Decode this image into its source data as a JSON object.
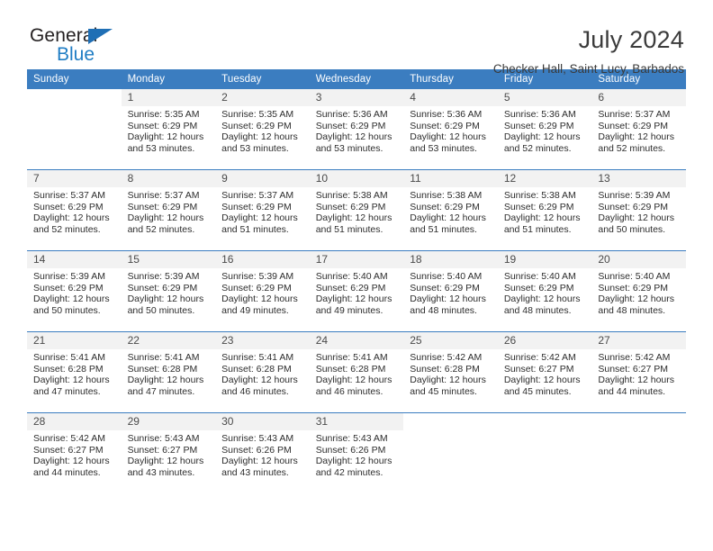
{
  "brand": {
    "name_part1": "General",
    "name_part2": "Blue",
    "triangle_color": "#1f6fb5"
  },
  "header": {
    "title": "July 2024",
    "subtitle": "Checker Hall, Saint Lucy, Barbados"
  },
  "theme": {
    "header_bg": "#3b7dc0",
    "daynum_bg": "#f2f2f2",
    "rule_color": "#3b7dc0",
    "text_color": "#2d2d2d"
  },
  "weekday_headers": [
    "Sunday",
    "Monday",
    "Tuesday",
    "Wednesday",
    "Thursday",
    "Friday",
    "Saturday"
  ],
  "weeks": [
    [
      {
        "day": "",
        "sunrise": "",
        "sunset": "",
        "daylight1": "",
        "daylight2": "",
        "blank": true
      },
      {
        "day": "1",
        "sunrise": "Sunrise: 5:35 AM",
        "sunset": "Sunset: 6:29 PM",
        "daylight1": "Daylight: 12 hours",
        "daylight2": "and 53 minutes."
      },
      {
        "day": "2",
        "sunrise": "Sunrise: 5:35 AM",
        "sunset": "Sunset: 6:29 PM",
        "daylight1": "Daylight: 12 hours",
        "daylight2": "and 53 minutes."
      },
      {
        "day": "3",
        "sunrise": "Sunrise: 5:36 AM",
        "sunset": "Sunset: 6:29 PM",
        "daylight1": "Daylight: 12 hours",
        "daylight2": "and 53 minutes."
      },
      {
        "day": "4",
        "sunrise": "Sunrise: 5:36 AM",
        "sunset": "Sunset: 6:29 PM",
        "daylight1": "Daylight: 12 hours",
        "daylight2": "and 53 minutes."
      },
      {
        "day": "5",
        "sunrise": "Sunrise: 5:36 AM",
        "sunset": "Sunset: 6:29 PM",
        "daylight1": "Daylight: 12 hours",
        "daylight2": "and 52 minutes."
      },
      {
        "day": "6",
        "sunrise": "Sunrise: 5:37 AM",
        "sunset": "Sunset: 6:29 PM",
        "daylight1": "Daylight: 12 hours",
        "daylight2": "and 52 minutes."
      }
    ],
    [
      {
        "day": "7",
        "sunrise": "Sunrise: 5:37 AM",
        "sunset": "Sunset: 6:29 PM",
        "daylight1": "Daylight: 12 hours",
        "daylight2": "and 52 minutes."
      },
      {
        "day": "8",
        "sunrise": "Sunrise: 5:37 AM",
        "sunset": "Sunset: 6:29 PM",
        "daylight1": "Daylight: 12 hours",
        "daylight2": "and 52 minutes."
      },
      {
        "day": "9",
        "sunrise": "Sunrise: 5:37 AM",
        "sunset": "Sunset: 6:29 PM",
        "daylight1": "Daylight: 12 hours",
        "daylight2": "and 51 minutes."
      },
      {
        "day": "10",
        "sunrise": "Sunrise: 5:38 AM",
        "sunset": "Sunset: 6:29 PM",
        "daylight1": "Daylight: 12 hours",
        "daylight2": "and 51 minutes."
      },
      {
        "day": "11",
        "sunrise": "Sunrise: 5:38 AM",
        "sunset": "Sunset: 6:29 PM",
        "daylight1": "Daylight: 12 hours",
        "daylight2": "and 51 minutes."
      },
      {
        "day": "12",
        "sunrise": "Sunrise: 5:38 AM",
        "sunset": "Sunset: 6:29 PM",
        "daylight1": "Daylight: 12 hours",
        "daylight2": "and 51 minutes."
      },
      {
        "day": "13",
        "sunrise": "Sunrise: 5:39 AM",
        "sunset": "Sunset: 6:29 PM",
        "daylight1": "Daylight: 12 hours",
        "daylight2": "and 50 minutes."
      }
    ],
    [
      {
        "day": "14",
        "sunrise": "Sunrise: 5:39 AM",
        "sunset": "Sunset: 6:29 PM",
        "daylight1": "Daylight: 12 hours",
        "daylight2": "and 50 minutes."
      },
      {
        "day": "15",
        "sunrise": "Sunrise: 5:39 AM",
        "sunset": "Sunset: 6:29 PM",
        "daylight1": "Daylight: 12 hours",
        "daylight2": "and 50 minutes."
      },
      {
        "day": "16",
        "sunrise": "Sunrise: 5:39 AM",
        "sunset": "Sunset: 6:29 PM",
        "daylight1": "Daylight: 12 hours",
        "daylight2": "and 49 minutes."
      },
      {
        "day": "17",
        "sunrise": "Sunrise: 5:40 AM",
        "sunset": "Sunset: 6:29 PM",
        "daylight1": "Daylight: 12 hours",
        "daylight2": "and 49 minutes."
      },
      {
        "day": "18",
        "sunrise": "Sunrise: 5:40 AM",
        "sunset": "Sunset: 6:29 PM",
        "daylight1": "Daylight: 12 hours",
        "daylight2": "and 48 minutes."
      },
      {
        "day": "19",
        "sunrise": "Sunrise: 5:40 AM",
        "sunset": "Sunset: 6:29 PM",
        "daylight1": "Daylight: 12 hours",
        "daylight2": "and 48 minutes."
      },
      {
        "day": "20",
        "sunrise": "Sunrise: 5:40 AM",
        "sunset": "Sunset: 6:29 PM",
        "daylight1": "Daylight: 12 hours",
        "daylight2": "and 48 minutes."
      }
    ],
    [
      {
        "day": "21",
        "sunrise": "Sunrise: 5:41 AM",
        "sunset": "Sunset: 6:28 PM",
        "daylight1": "Daylight: 12 hours",
        "daylight2": "and 47 minutes."
      },
      {
        "day": "22",
        "sunrise": "Sunrise: 5:41 AM",
        "sunset": "Sunset: 6:28 PM",
        "daylight1": "Daylight: 12 hours",
        "daylight2": "and 47 minutes."
      },
      {
        "day": "23",
        "sunrise": "Sunrise: 5:41 AM",
        "sunset": "Sunset: 6:28 PM",
        "daylight1": "Daylight: 12 hours",
        "daylight2": "and 46 minutes."
      },
      {
        "day": "24",
        "sunrise": "Sunrise: 5:41 AM",
        "sunset": "Sunset: 6:28 PM",
        "daylight1": "Daylight: 12 hours",
        "daylight2": "and 46 minutes."
      },
      {
        "day": "25",
        "sunrise": "Sunrise: 5:42 AM",
        "sunset": "Sunset: 6:28 PM",
        "daylight1": "Daylight: 12 hours",
        "daylight2": "and 45 minutes."
      },
      {
        "day": "26",
        "sunrise": "Sunrise: 5:42 AM",
        "sunset": "Sunset: 6:27 PM",
        "daylight1": "Daylight: 12 hours",
        "daylight2": "and 45 minutes."
      },
      {
        "day": "27",
        "sunrise": "Sunrise: 5:42 AM",
        "sunset": "Sunset: 6:27 PM",
        "daylight1": "Daylight: 12 hours",
        "daylight2": "and 44 minutes."
      }
    ],
    [
      {
        "day": "28",
        "sunrise": "Sunrise: 5:42 AM",
        "sunset": "Sunset: 6:27 PM",
        "daylight1": "Daylight: 12 hours",
        "daylight2": "and 44 minutes."
      },
      {
        "day": "29",
        "sunrise": "Sunrise: 5:43 AM",
        "sunset": "Sunset: 6:27 PM",
        "daylight1": "Daylight: 12 hours",
        "daylight2": "and 43 minutes."
      },
      {
        "day": "30",
        "sunrise": "Sunrise: 5:43 AM",
        "sunset": "Sunset: 6:26 PM",
        "daylight1": "Daylight: 12 hours",
        "daylight2": "and 43 minutes."
      },
      {
        "day": "31",
        "sunrise": "Sunrise: 5:43 AM",
        "sunset": "Sunset: 6:26 PM",
        "daylight1": "Daylight: 12 hours",
        "daylight2": "and 42 minutes."
      },
      {
        "day": "",
        "sunrise": "",
        "sunset": "",
        "daylight1": "",
        "daylight2": "",
        "blank": true
      },
      {
        "day": "",
        "sunrise": "",
        "sunset": "",
        "daylight1": "",
        "daylight2": "",
        "blank": true
      },
      {
        "day": "",
        "sunrise": "",
        "sunset": "",
        "daylight1": "",
        "daylight2": "",
        "blank": true
      }
    ]
  ]
}
